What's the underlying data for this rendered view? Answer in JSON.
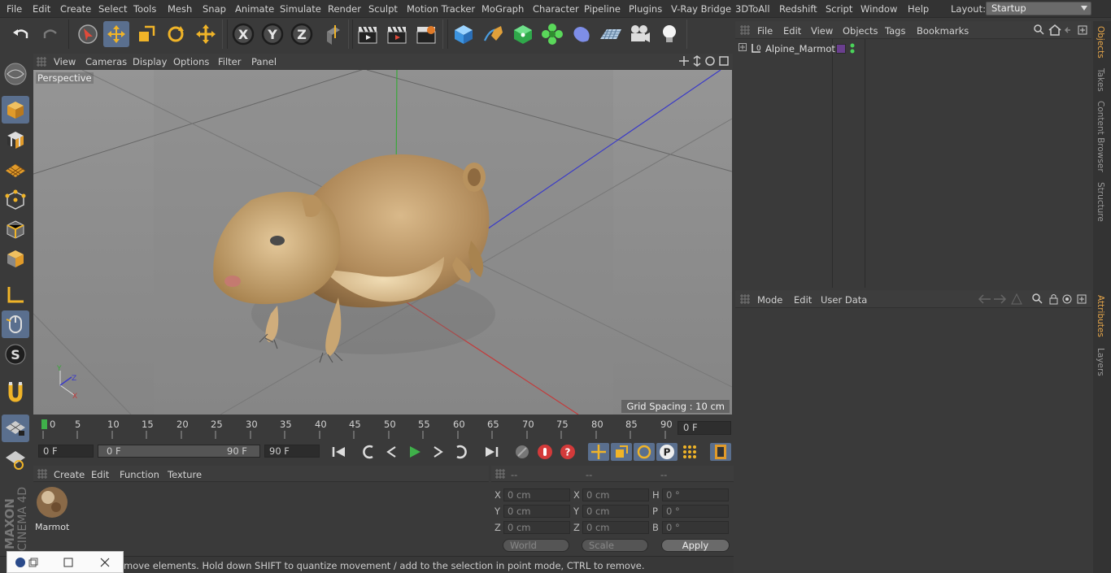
{
  "menubar": {
    "items": [
      "File",
      "Edit",
      "Create",
      "Select",
      "Tools",
      "Mesh",
      "Snap",
      "Animate",
      "Simulate",
      "Render",
      "Sculpt",
      "Motion Tracker",
      "MoGraph",
      "Character",
      "Pipeline",
      "Plugins",
      "V-Ray Bridge",
      "3DToAll",
      "Redshift",
      "Script",
      "Window",
      "Help"
    ],
    "layout_label": "Layout:",
    "layout_value": "Startup"
  },
  "viewport": {
    "menu": [
      "View",
      "Cameras",
      "Display",
      "Options",
      "Filter",
      "Panel"
    ],
    "label": "Perspective",
    "grid_spacing": "Grid Spacing : 10 cm"
  },
  "timeline": {
    "ticks": [
      "0",
      "5",
      "10",
      "15",
      "20",
      "25",
      "30",
      "35",
      "40",
      "45",
      "50",
      "55",
      "60",
      "65",
      "70",
      "75",
      "80",
      "85",
      "90"
    ],
    "current_frame": "0 F"
  },
  "transport": {
    "start_field": "0 F",
    "range_start": "0 F",
    "range_end": "90 F",
    "end_field": "90 F"
  },
  "material_panel": {
    "menu": [
      "Create",
      "Edit",
      "Function",
      "Texture"
    ],
    "material_name": "Marmot"
  },
  "coord_panel": {
    "headers": [
      "--",
      "--",
      "--"
    ],
    "rows": [
      {
        "l1": "X",
        "v1": "0 cm",
        "l2": "X",
        "v2": "0 cm",
        "l3": "H",
        "v3": "0 °"
      },
      {
        "l1": "Y",
        "v1": "0 cm",
        "l2": "Y",
        "v2": "0 cm",
        "l3": "P",
        "v3": "0 °"
      },
      {
        "l1": "Z",
        "v1": "0 cm",
        "l2": "Z",
        "v2": "0 cm",
        "l3": "B",
        "v3": "0 °"
      }
    ],
    "world": "World",
    "scale": "Scale",
    "apply": "Apply"
  },
  "status": {
    "text": "move elements. Hold down SHIFT to quantize movement / add to the selection in point mode, CTRL to remove."
  },
  "object_panel": {
    "menu": [
      "File",
      "Edit",
      "View",
      "Objects",
      "Tags",
      "Bookmarks"
    ],
    "object_name": "Alpine_Marmot",
    "object_color": "#6a3f8e"
  },
  "attr_panel": {
    "menu": [
      "Mode",
      "Edit",
      "User Data"
    ]
  },
  "side_tabs": [
    "Objects",
    "Takes",
    "Content Browser",
    "Structure",
    "Attributes",
    "Layers"
  ],
  "brand": {
    "line1": "MAXON",
    "line2": "CINEMA 4D"
  },
  "colors": {
    "accent": "#5a6f8e",
    "active_tab": "#e8a74a",
    "play_green": "#3fb04a",
    "record_red": "#d33a3a"
  }
}
